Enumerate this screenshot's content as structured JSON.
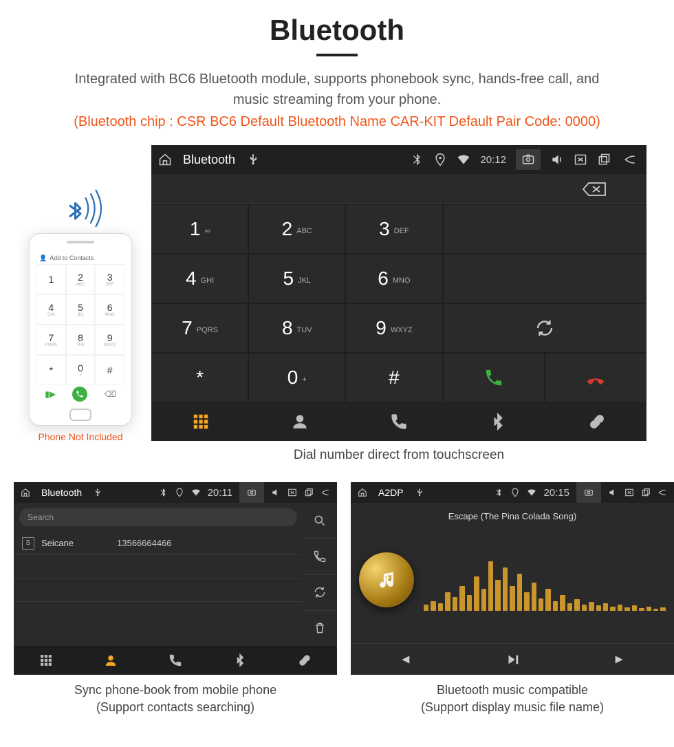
{
  "title": "Bluetooth",
  "description": "Integrated with BC6 Bluetooth module, supports phonebook sync, hands-free call, and music streaming from your phone.",
  "spec": "(Bluetooth chip : CSR BC6     Default Bluetooth Name CAR-KIT    Default Pair Code: 0000)",
  "phone_caption": "Phone Not Included",
  "phone_mock": {
    "add_contacts": "Add to Contacts",
    "keys": [
      {
        "n": "1",
        "s": ""
      },
      {
        "n": "2",
        "s": "ABC"
      },
      {
        "n": "3",
        "s": "DEF"
      },
      {
        "n": "4",
        "s": "GHI"
      },
      {
        "n": "5",
        "s": "JKL"
      },
      {
        "n": "6",
        "s": "MNO"
      },
      {
        "n": "7",
        "s": "PQRS"
      },
      {
        "n": "8",
        "s": "TUV"
      },
      {
        "n": "9",
        "s": "WXYZ"
      },
      {
        "n": "*",
        "s": ""
      },
      {
        "n": "0",
        "s": "+"
      },
      {
        "n": "#",
        "s": ""
      }
    ]
  },
  "main_panel": {
    "title": "Bluetooth",
    "time": "20:12",
    "keys": [
      {
        "n": "1",
        "s": "∞"
      },
      {
        "n": "2",
        "s": "ABC"
      },
      {
        "n": "3",
        "s": "DEF"
      },
      {
        "n": "4",
        "s": "GHI"
      },
      {
        "n": "5",
        "s": "JKL"
      },
      {
        "n": "6",
        "s": "MNO"
      },
      {
        "n": "7",
        "s": "PQRS"
      },
      {
        "n": "8",
        "s": "TUV"
      },
      {
        "n": "9",
        "s": "WXYZ"
      },
      {
        "n": "*",
        "s": ""
      },
      {
        "n": "0",
        "s": "+"
      },
      {
        "n": "#",
        "s": ""
      }
    ],
    "caption": "Dial number direct from touchscreen"
  },
  "phonebook_panel": {
    "title": "Bluetooth",
    "time": "20:11",
    "search_placeholder": "Search",
    "contact": {
      "initial": "S",
      "name": "Seicane",
      "number": "13566664466"
    },
    "caption1": "Sync phone-book from mobile phone",
    "caption2": "(Support contacts searching)"
  },
  "music_panel": {
    "title": "A2DP",
    "time": "20:15",
    "track": "Escape (The Pina Colada Song)",
    "caption1": "Bluetooth music compatible",
    "caption2": "(Support display music file name)"
  }
}
